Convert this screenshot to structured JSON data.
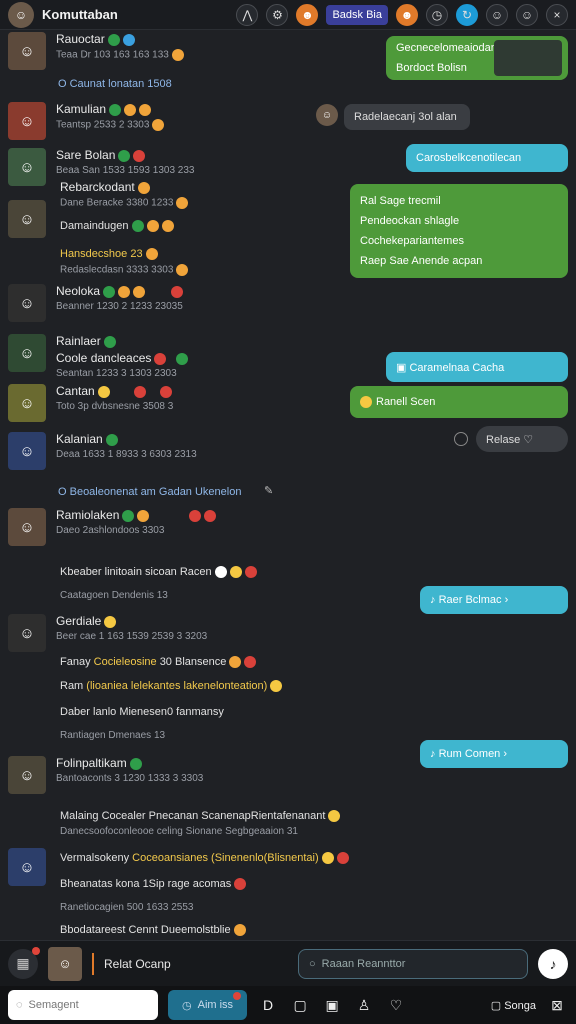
{
  "header": {
    "title": "Komuttaban",
    "badge": "Badsk Bia"
  },
  "rows": [
    {
      "name": "Rauoctar",
      "meta": "Teaa Dr 103 163 163 133"
    },
    {
      "name": "Kamulian",
      "meta": "Teantsp 2533 2 3303"
    },
    {
      "name": "Sare Bolan",
      "meta": "Beaa San 1533 1593 1303 233"
    },
    {
      "name": "Rebarckodant",
      "meta": "Dane Beracke 3380 1233"
    },
    {
      "name": "Damaindugen",
      "meta": "Hansdecshoe 23"
    },
    {
      "name": "Neoloka",
      "meta": "Beanner 1230 2 1233 23035"
    },
    {
      "name": "Rainlaer",
      "meta": "Coole dancleaces"
    },
    {
      "name": "Cantan",
      "meta": "Toto 3p dvbsnesne 3508 3"
    },
    {
      "name": "Kalanian",
      "meta": "Deaa 1633 1 8933 3 6303 2313"
    },
    {
      "name": "Ramiolaken",
      "meta": "Daeo 2ashlondoos 3303"
    },
    {
      "name": "Gerdiale",
      "meta": "Beer cae 1 163 1539 2539 3 3203"
    },
    {
      "name": "Folinpaltikam",
      "meta": "Bantoaconts 3 1230 1333 3 3303"
    }
  ],
  "sections": {
    "s1": "O Caunat lonatan 1508",
    "s2": "O Beoaleonenat am Gadan Ukenelon"
  },
  "lines": {
    "l1": "Redaslecdasn 3333 3303",
    "l2": "Seantan 1233 3 1303 2303",
    "l3": "Kbeaber linitoain sicoan Racen",
    "l4": "Caatagoen Dendenis 13",
    "l5": "Fanay",
    "l5y": "Cocieleosine",
    "l5b": "30 Blansence",
    "l6": "Ram",
    "l6y": "(lioaniea lelekantes",
    "l6b": "lakenelonteation)",
    "l7": "Daber lanlo Mienesen0 fanmansy",
    "l8": "Rantiagen Dmenaes 13",
    "l9": "Malaing Cocealer Pnecanan ScanenapRientafenanant",
    "l10": "Danecsoofoconleooe celing Sionane Segbgeaaion 31",
    "l11": "Vermalsokeny",
    "l11y": "Coceoansianes (Sinenenlo(Blisnentai)",
    "l12": "Bheanatas kona 1Sip rage acomas",
    "l13": "Ranetiocagien 500 1633 2553",
    "l14": "Bbodatareest Cennt Dueemolstblie"
  },
  "bubbles": {
    "g1a": "Gecnecelomeaiodan",
    "g1b": "Bordoct Bolisn",
    "d1": "Radelaecanj 3ol alan",
    "t1": "Carosbelkcenotilecan",
    "g2a": "Ral Sage trecmil",
    "g2b": "Pendeockan shlagle",
    "g2c": "Cochekepariantemes",
    "g2d": "Raep Sae Anende acpan",
    "t2": "Caramelnaa Cacha",
    "g3": "Ranell Scen",
    "d2": "Relase",
    "t3": "Raer Bclmac",
    "t4": "Rum Comen"
  },
  "composer": {
    "name": "Relat Ocanp",
    "search_placeholder": "Raaan Reannttor"
  },
  "bottombar": {
    "input_placeholder": "Semagent",
    "add_label": "Aim iss",
    "right_text": "Songa"
  }
}
